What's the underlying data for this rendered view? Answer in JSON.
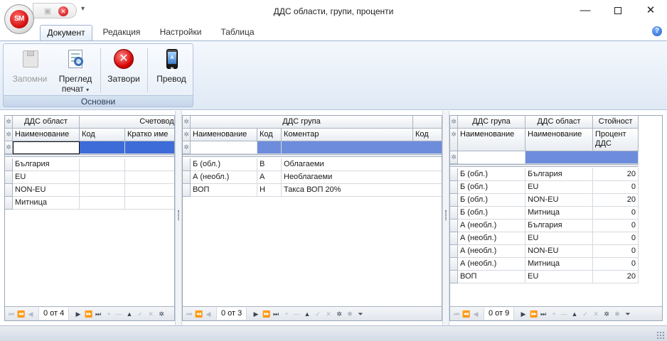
{
  "window": {
    "title": "ДДС области, групи, проценти",
    "app_badge": "SM",
    "minimize": "—",
    "close": "✕"
  },
  "ribbon": {
    "tabs": [
      "Документ",
      "Редакция",
      "Настройки",
      "Таблица"
    ],
    "active_tab": "Документ",
    "group_label": "Основни",
    "buttons": {
      "save": "Запомни",
      "preview_line1": "Преглед",
      "preview_line2": "печат",
      "close": "Затвори",
      "translate": "Превод"
    }
  },
  "grid1": {
    "band_headers": [
      "ДДС област",
      "Счетоводство"
    ],
    "columns": [
      "Наименование",
      "Код",
      "Кратко име"
    ],
    "rows": [
      [
        "България",
        "",
        ""
      ],
      [
        "EU",
        "",
        ""
      ],
      [
        "NON-EU",
        "",
        ""
      ],
      [
        "Митница",
        "",
        ""
      ]
    ],
    "count": "0 от 4"
  },
  "grid2": {
    "band_headers": [
      "ДДС група"
    ],
    "columns": [
      "Наименование",
      "Код",
      "Коментар",
      "Код"
    ],
    "rows": [
      [
        "Б (обл.)",
        "В",
        "Облагаеми"
      ],
      [
        "А (необл.)",
        "А",
        "Необлагаеми"
      ],
      [
        "ВОП",
        "Н",
        "Такса ВОП 20%"
      ]
    ],
    "count": "0 от 3"
  },
  "grid3": {
    "band_headers": [
      "ДДС група",
      "ДДС област",
      "Стойност"
    ],
    "columns": [
      "Наименование",
      "Наименование",
      "Процент ДДС"
    ],
    "rows": [
      [
        "Б (обл.)",
        "България",
        "20"
      ],
      [
        "Б (обл.)",
        "EU",
        "0"
      ],
      [
        "Б (обл.)",
        "NON-EU",
        "20"
      ],
      [
        "Б (обл.)",
        "Митница",
        "0"
      ],
      [
        "А (необл.)",
        "България",
        "0"
      ],
      [
        "А (необл.)",
        "EU",
        "0"
      ],
      [
        "А (необл.)",
        "NON-EU",
        "0"
      ],
      [
        "А (необл.)",
        "Митница",
        "0"
      ],
      [
        "ВОП",
        "EU",
        "20"
      ]
    ],
    "count": "0 от 9"
  },
  "colors": {
    "ribbon_border": "#9fb4d3",
    "filter_highlight": "#6d8ddc",
    "close_red": "#d40000"
  }
}
